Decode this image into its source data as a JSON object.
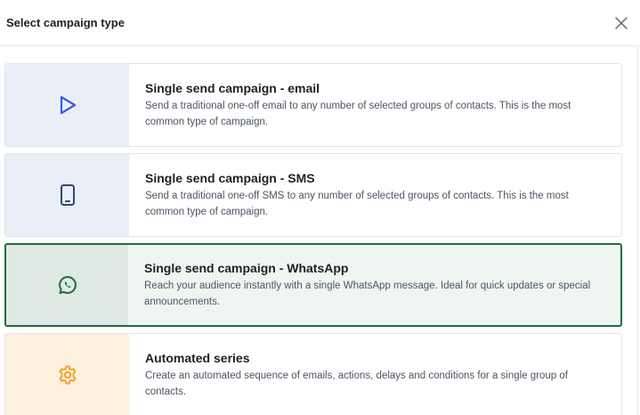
{
  "modal": {
    "title": "Select campaign type",
    "close_icon": "close-icon"
  },
  "campaigns": [
    {
      "title": "Single send campaign - email",
      "description": "Send a traditional one-off email to any number of selected groups of contacts. This is the most common type of campaign.",
      "icon": "play-icon",
      "selected": false
    },
    {
      "title": "Single send campaign - SMS",
      "description": "Send a traditional one-off SMS to any number of selected groups of contacts. This is the most common type of campaign.",
      "icon": "mobile-phone-icon",
      "selected": false
    },
    {
      "title": "Single send campaign - WhatsApp",
      "description": "Reach your audience instantly with a single WhatsApp message. Ideal for quick updates or special announcements.",
      "icon": "whatsapp-icon",
      "selected": true
    },
    {
      "title": "Automated series",
      "description": "Create an automated sequence of emails, actions, delays and conditions for a single group of contacts.",
      "icon": "gear-icon",
      "selected": false
    }
  ],
  "colors": {
    "email_icon": "#3b5bd9",
    "sms_icon": "#2d4a6e",
    "whatsapp_icon": "#1e6b46",
    "automated_icon": "#f0a22e",
    "selected_border": "#1e6b46"
  }
}
